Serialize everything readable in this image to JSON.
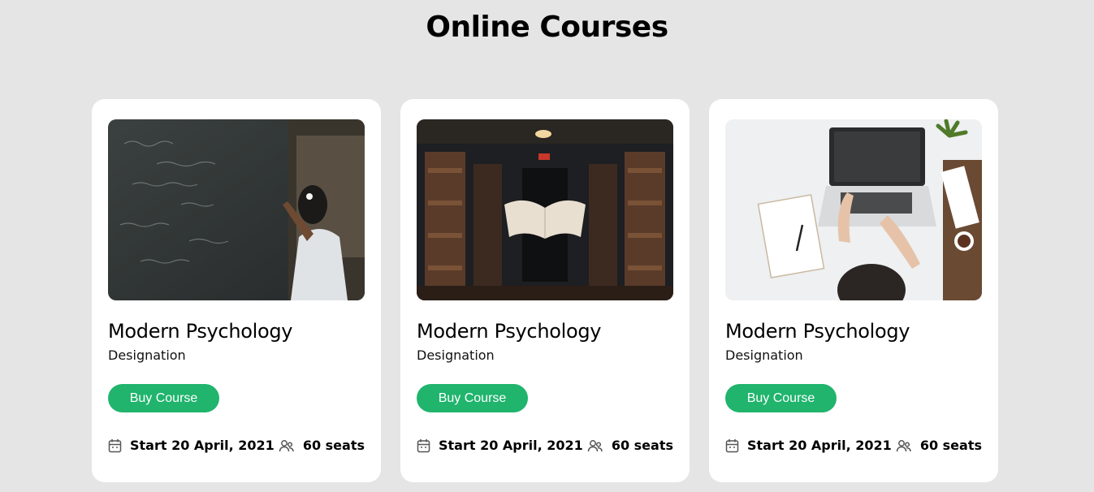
{
  "page": {
    "title": "Online Courses"
  },
  "colors": {
    "background": "#e5e5e5",
    "card": "#ffffff",
    "accent": "#20b46d"
  },
  "courses": [
    {
      "image": "student-writing-on-chalkboard",
      "title": "Modern Psychology",
      "designation": "Designation",
      "button_label": "Buy Course",
      "start_date": "Start 20 April, 2021",
      "seats": "60 seats",
      "date_icon": "calendar-icon",
      "seats_icon": "users-icon"
    },
    {
      "image": "library-with-floating-book",
      "title": "Modern Psychology",
      "designation": "Designation",
      "button_label": "Buy Course",
      "start_date": "Start 20 April, 2021",
      "seats": "60 seats",
      "date_icon": "calendar-icon",
      "seats_icon": "users-icon"
    },
    {
      "image": "person-working-on-laptop",
      "title": "Modern Psychology",
      "designation": "Designation",
      "button_label": "Buy Course",
      "start_date": "Start 20 April, 2021",
      "seats": "60 seats",
      "date_icon": "calendar-icon",
      "seats_icon": "users-icon"
    }
  ]
}
